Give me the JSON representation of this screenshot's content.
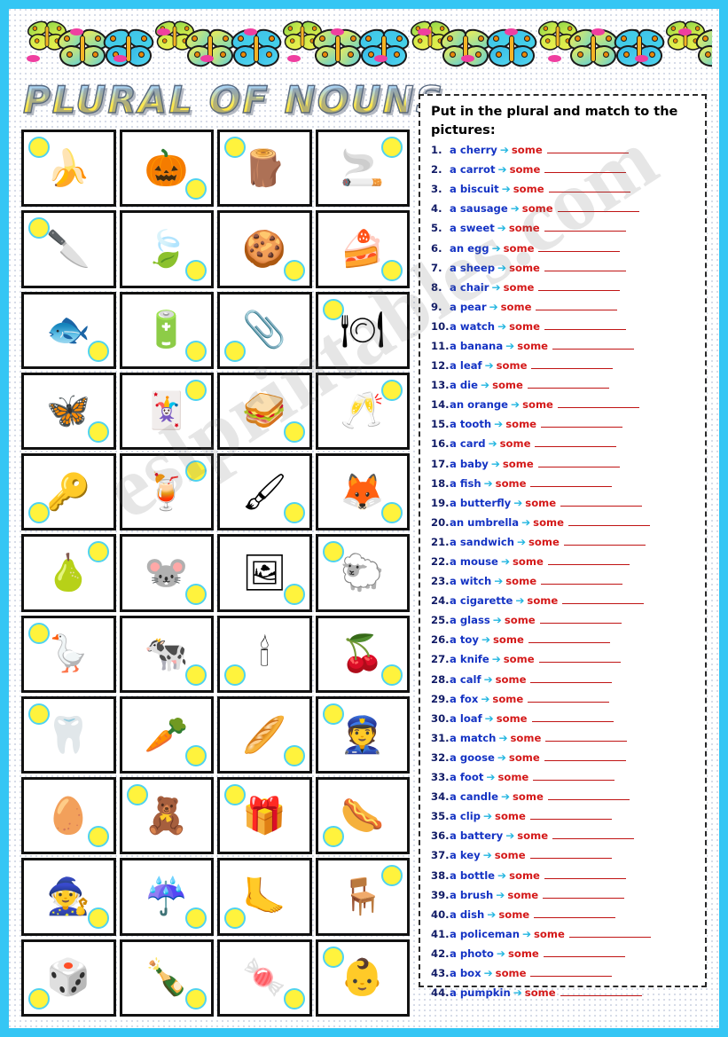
{
  "worksheet": {
    "title": "PLURAL OF NOUNS",
    "watermark": "eslprintables.com",
    "border_color": "#35c6f4",
    "accent_colors": {
      "noun": "#1433c4",
      "some": "#d41818",
      "arrow": "#22b6e0",
      "number": "#111b66",
      "bubble_fill": "#fff33d",
      "bubble_ring": "#4fd3ef"
    }
  },
  "panel": {
    "instruction": "Put in the plural and match to the pictures:",
    "arrow_glyph": "➔",
    "some_label": "some",
    "items": [
      {
        "n": "1.",
        "noun": "a cherry"
      },
      {
        "n": "2.",
        "noun": "a carrot"
      },
      {
        "n": "3.",
        "noun": "a biscuit"
      },
      {
        "n": "4.",
        "noun": "a sausage"
      },
      {
        "n": "5.",
        "noun": "a sweet"
      },
      {
        "n": "6.",
        "noun": "an egg"
      },
      {
        "n": "7.",
        "noun": "a sheep"
      },
      {
        "n": "8.",
        "noun": "a chair"
      },
      {
        "n": "9.",
        "noun": "a pear"
      },
      {
        "n": "10.",
        "noun": "a watch"
      },
      {
        "n": "11.",
        "noun": "a banana"
      },
      {
        "n": "12.",
        "noun": "a leaf"
      },
      {
        "n": "13.",
        "noun": "a die"
      },
      {
        "n": "14.",
        "noun": "an orange"
      },
      {
        "n": "15.",
        "noun": "a tooth"
      },
      {
        "n": "16.",
        "noun": "a card"
      },
      {
        "n": "17.",
        "noun": "a baby"
      },
      {
        "n": "18.",
        "noun": "a fish"
      },
      {
        "n": "19.",
        "noun": "a butterfly"
      },
      {
        "n": "20.",
        "noun": "an umbrella"
      },
      {
        "n": "21.",
        "noun": "a sandwich"
      },
      {
        "n": "22.",
        "noun": "a mouse"
      },
      {
        "n": "23.",
        "noun": "a witch"
      },
      {
        "n": "24.",
        "noun": "a cigarette"
      },
      {
        "n": "25.",
        "noun": "a glass"
      },
      {
        "n": "26.",
        "noun": "a toy"
      },
      {
        "n": "27.",
        "noun": "a knife"
      },
      {
        "n": "28.",
        "noun": "a calf"
      },
      {
        "n": "29.",
        "noun": "a fox"
      },
      {
        "n": "30.",
        "noun": "a loaf"
      },
      {
        "n": "31.",
        "noun": "a match"
      },
      {
        "n": "32.",
        "noun": "a goose"
      },
      {
        "n": "33.",
        "noun": "a foot"
      },
      {
        "n": "34.",
        "noun": "a candle"
      },
      {
        "n": "35.",
        "noun": "a clip"
      },
      {
        "n": "36.",
        "noun": "a battery"
      },
      {
        "n": "37.",
        "noun": "a key"
      },
      {
        "n": "38.",
        "noun": "a bottle"
      },
      {
        "n": "39.",
        "noun": "a brush"
      },
      {
        "n": "40.",
        "noun": "a dish"
      },
      {
        "n": "41.",
        "noun": "a policeman"
      },
      {
        "n": "42.",
        "noun": "a photo"
      },
      {
        "n": "43.",
        "noun": "a box"
      },
      {
        "n": "44.",
        "noun": "a pumpkin"
      }
    ]
  },
  "grid": {
    "columns": 4,
    "rows": 11,
    "cells": [
      {
        "name": "bananas",
        "glyph": "🍌",
        "bubble": "b-tl",
        "size": ""
      },
      {
        "name": "pumpkins",
        "glyph": "🎃",
        "bubble": "b-br",
        "size": ""
      },
      {
        "name": "matches",
        "glyph": "🪵",
        "bubble": "b-tl",
        "size": ""
      },
      {
        "name": "cigarettes",
        "glyph": "🚬",
        "bubble": "b-tr",
        "size": ""
      },
      {
        "name": "knives",
        "glyph": "🔪",
        "bubble": "b-tl",
        "size": ""
      },
      {
        "name": "leaves",
        "glyph": "🍃",
        "bubble": "b-br",
        "size": ""
      },
      {
        "name": "biscuits",
        "glyph": "🍪",
        "bubble": "b-br",
        "size": ""
      },
      {
        "name": "cakes",
        "glyph": "🍰",
        "bubble": "b-br",
        "size": ""
      },
      {
        "name": "fish",
        "glyph": "🐟",
        "bubble": "b-br",
        "size": ""
      },
      {
        "name": "batteries",
        "glyph": "🔋",
        "bubble": "b-br",
        "size": ""
      },
      {
        "name": "clips",
        "glyph": "📎",
        "bubble": "b-bl",
        "size": ""
      },
      {
        "name": "dishes",
        "glyph": "🍽",
        "bubble": "b-tl",
        "size": ""
      },
      {
        "name": "butterflies",
        "glyph": "🦋",
        "bubble": "b-br",
        "size": ""
      },
      {
        "name": "cards",
        "glyph": "🃏",
        "bubble": "b-tr",
        "size": ""
      },
      {
        "name": "sandwiches",
        "glyph": "🥪",
        "bubble": "b-br",
        "size": ""
      },
      {
        "name": "glasses",
        "glyph": "🥂",
        "bubble": "b-tr",
        "size": ""
      },
      {
        "name": "keys",
        "glyph": "🔑",
        "bubble": "b-bl",
        "size": ""
      },
      {
        "name": "oranges",
        "glyph": "🍹",
        "bubble": "b-tr",
        "size": ""
      },
      {
        "name": "brushes",
        "glyph": "🖌",
        "bubble": "b-br",
        "size": ""
      },
      {
        "name": "foxes",
        "glyph": "🦊",
        "bubble": "b-br",
        "size": ""
      },
      {
        "name": "pears",
        "glyph": "🍐",
        "bubble": "b-tr",
        "size": ""
      },
      {
        "name": "mice",
        "glyph": "🐭",
        "bubble": "b-br",
        "size": ""
      },
      {
        "name": "photos",
        "glyph": "🖼",
        "bubble": "b-br",
        "size": ""
      },
      {
        "name": "sheep",
        "glyph": "🐑",
        "bubble": "b-tl",
        "size": ""
      },
      {
        "name": "geese",
        "glyph": "🪿",
        "bubble": "b-tl",
        "size": ""
      },
      {
        "name": "calves",
        "glyph": "🐄",
        "bubble": "b-br",
        "size": ""
      },
      {
        "name": "candles",
        "glyph": "🕯",
        "bubble": "b-bl",
        "size": ""
      },
      {
        "name": "cherries",
        "glyph": "🍒",
        "bubble": "b-br",
        "size": ""
      },
      {
        "name": "teeth",
        "glyph": "🦷",
        "bubble": "b-tl",
        "size": ""
      },
      {
        "name": "carrots",
        "glyph": "🥕",
        "bubble": "b-br",
        "size": ""
      },
      {
        "name": "loaves",
        "glyph": "🥖",
        "bubble": "b-br",
        "size": ""
      },
      {
        "name": "policemen",
        "glyph": "👮",
        "bubble": "b-tl",
        "size": ""
      },
      {
        "name": "eggs",
        "glyph": "🥚",
        "bubble": "b-br",
        "size": ""
      },
      {
        "name": "toys",
        "glyph": "🧸",
        "bubble": "b-tl",
        "size": ""
      },
      {
        "name": "boxes",
        "glyph": "🎁",
        "bubble": "b-tl",
        "size": ""
      },
      {
        "name": "sausages",
        "glyph": "🌭",
        "bubble": "b-bl",
        "size": ""
      },
      {
        "name": "witches",
        "glyph": "🧙",
        "bubble": "b-br",
        "size": ""
      },
      {
        "name": "umbrellas",
        "glyph": "☔",
        "bubble": "b-br",
        "size": ""
      },
      {
        "name": "feet",
        "glyph": "🦶",
        "bubble": "b-bl",
        "size": ""
      },
      {
        "name": "chairs",
        "glyph": "🪑",
        "bubble": "b-tr",
        "size": ""
      },
      {
        "name": "dice",
        "glyph": "🎲",
        "bubble": "b-bl",
        "size": ""
      },
      {
        "name": "bottles",
        "glyph": "🍾",
        "bubble": "b-br",
        "size": ""
      },
      {
        "name": "sweets",
        "glyph": "🍬",
        "bubble": "b-br",
        "size": ""
      },
      {
        "name": "babies",
        "glyph": "👶",
        "bubble": "b-tl",
        "size": ""
      }
    ]
  }
}
